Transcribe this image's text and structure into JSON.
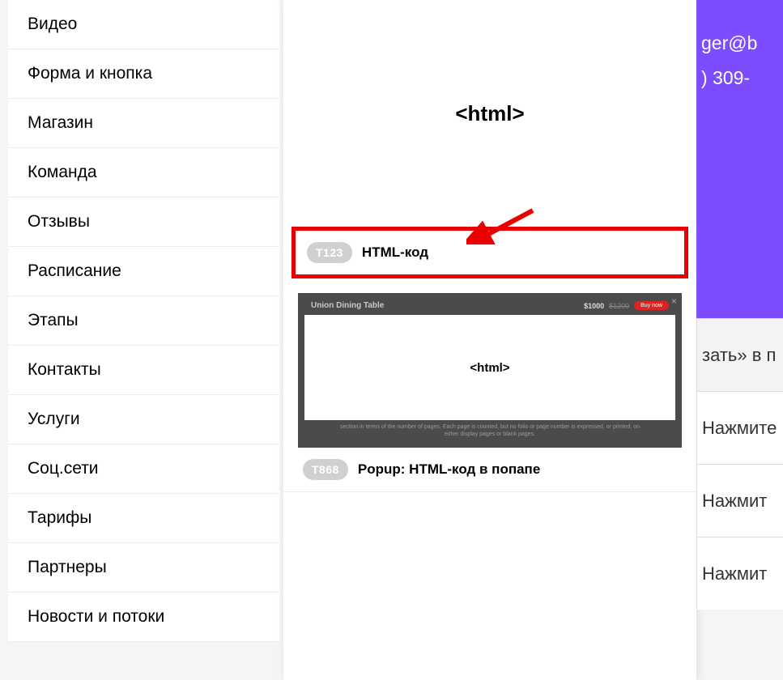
{
  "sidebar": {
    "items": [
      {
        "label": "Видео"
      },
      {
        "label": "Форма и кнопка"
      },
      {
        "label": "Магазин"
      },
      {
        "label": "Команда"
      },
      {
        "label": "Отзывы"
      },
      {
        "label": "Расписание"
      },
      {
        "label": "Этапы"
      },
      {
        "label": "Контакты"
      },
      {
        "label": "Услуги"
      },
      {
        "label": "Соц.сети"
      },
      {
        "label": "Тарифы"
      },
      {
        "label": "Партнеры"
      },
      {
        "label": "Новости и потоки"
      }
    ]
  },
  "blocks": {
    "preview1_tag": "<html>",
    "b1_badge": "T123",
    "b1_title": "HTML-код",
    "preview2": {
      "title": "Union Dining Table",
      "price": "$1000",
      "price_old": "$1200",
      "buy": "Buy now",
      "close": "×",
      "html_tag": "<html>",
      "footer": "section in terms of the number of pages. Each page is counted, but no folio or page number is expressed, or printed, on either display pages or blank pages."
    },
    "b2_badge": "T868",
    "b2_title": "Popup: HTML-код в попапе"
  },
  "right": {
    "line1": "ger@b",
    "line2": ") 309-",
    "cells": [
      "зать» в п",
      "Нажмите",
      "Нажмит",
      "Нажмит"
    ]
  }
}
